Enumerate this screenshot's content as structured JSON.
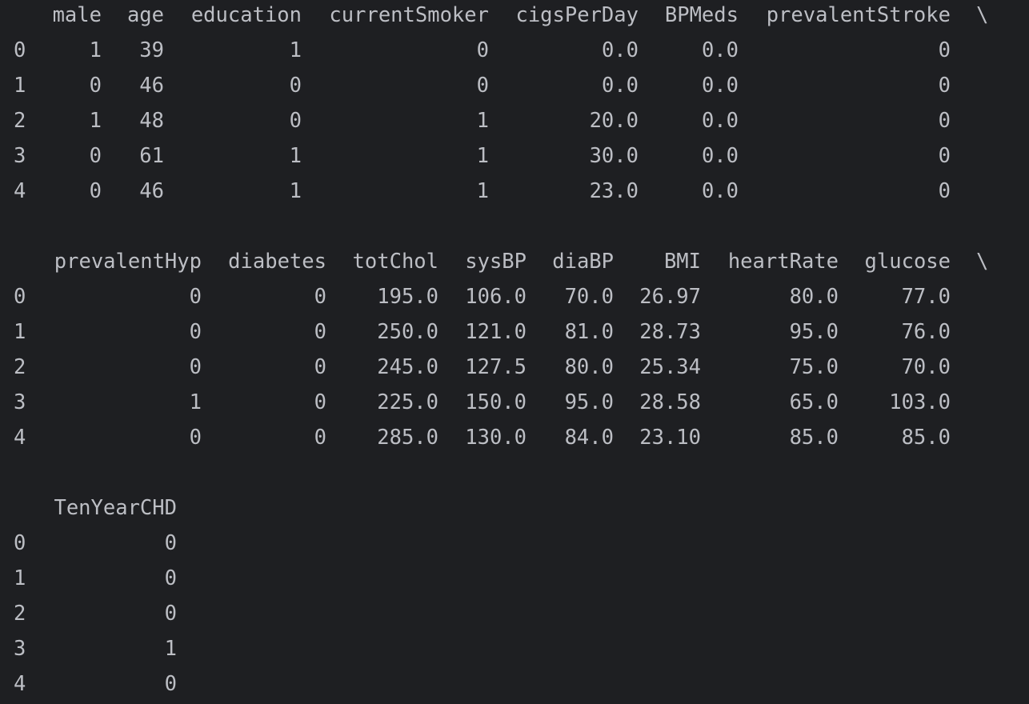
{
  "console": {
    "continuation": "\\",
    "blocks": [
      {
        "columns": [
          "male",
          "age",
          "education",
          "currentSmoker",
          "cigsPerDay",
          "BPMeds",
          "prevalentStroke"
        ],
        "rows": [
          {
            "index": "0",
            "values": [
              "1",
              "39",
              "1",
              "0",
              "0.0",
              "0.0",
              "0"
            ]
          },
          {
            "index": "1",
            "values": [
              "0",
              "46",
              "0",
              "0",
              "0.0",
              "0.0",
              "0"
            ]
          },
          {
            "index": "2",
            "values": [
              "1",
              "48",
              "0",
              "1",
              "20.0",
              "0.0",
              "0"
            ]
          },
          {
            "index": "3",
            "values": [
              "0",
              "61",
              "1",
              "1",
              "30.0",
              "0.0",
              "0"
            ]
          },
          {
            "index": "4",
            "values": [
              "0",
              "46",
              "1",
              "1",
              "23.0",
              "0.0",
              "0"
            ]
          }
        ]
      },
      {
        "columns": [
          "prevalentHyp",
          "diabetes",
          "totChol",
          "sysBP",
          "diaBP",
          "BMI",
          "heartRate",
          "glucose"
        ],
        "rows": [
          {
            "index": "0",
            "values": [
              "0",
              "0",
              "195.0",
              "106.0",
              "70.0",
              "26.97",
              "80.0",
              "77.0"
            ]
          },
          {
            "index": "1",
            "values": [
              "0",
              "0",
              "250.0",
              "121.0",
              "81.0",
              "28.73",
              "95.0",
              "76.0"
            ]
          },
          {
            "index": "2",
            "values": [
              "0",
              "0",
              "245.0",
              "127.5",
              "80.0",
              "25.34",
              "75.0",
              "70.0"
            ]
          },
          {
            "index": "3",
            "values": [
              "1",
              "0",
              "225.0",
              "150.0",
              "95.0",
              "28.58",
              "65.0",
              "103.0"
            ]
          },
          {
            "index": "4",
            "values": [
              "0",
              "0",
              "285.0",
              "130.0",
              "84.0",
              "23.10",
              "85.0",
              "85.0"
            ]
          }
        ]
      },
      {
        "columns": [
          "TenYearCHD"
        ],
        "rows": [
          {
            "index": "0",
            "values": [
              "0"
            ]
          },
          {
            "index": "1",
            "values": [
              "0"
            ]
          },
          {
            "index": "2",
            "values": [
              "0"
            ]
          },
          {
            "index": "3",
            "values": [
              "1"
            ]
          },
          {
            "index": "4",
            "values": [
              "0"
            ]
          }
        ]
      }
    ]
  }
}
